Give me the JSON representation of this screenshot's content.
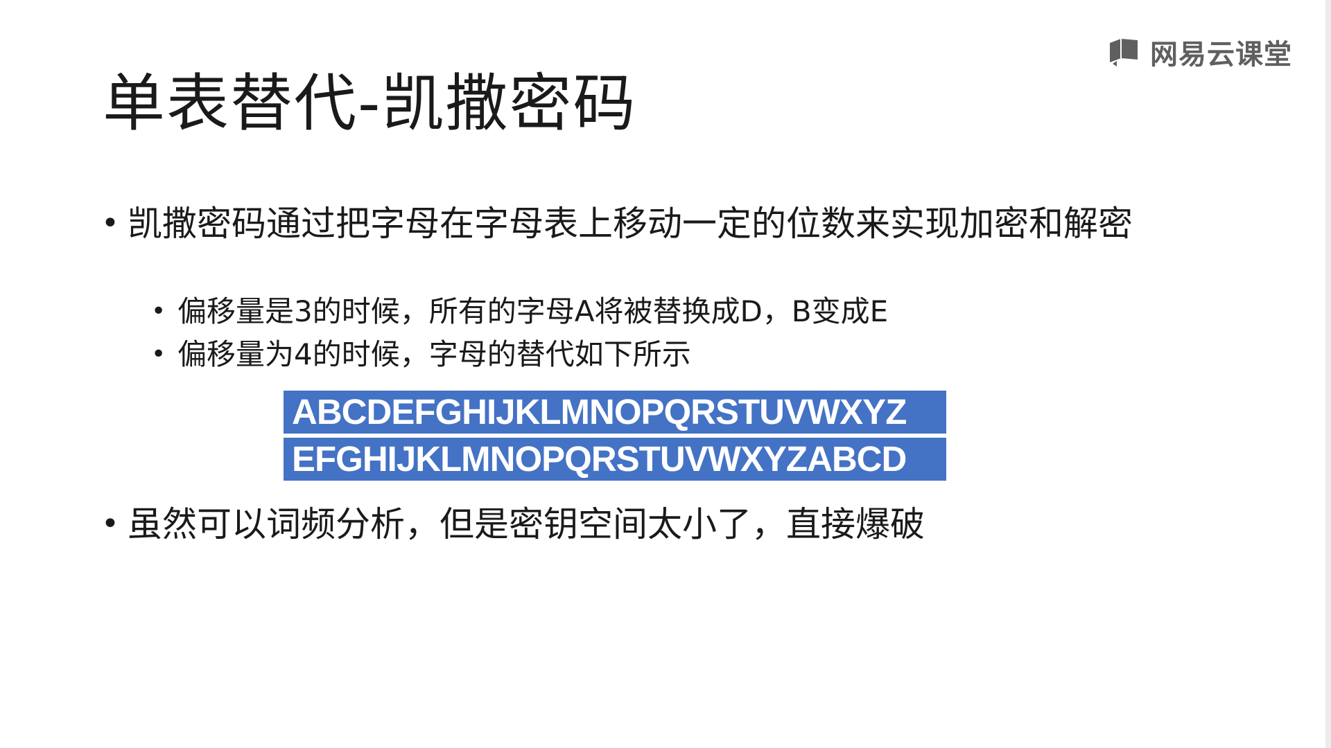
{
  "watermark": {
    "text": "网易云课堂",
    "icon": "book-icon"
  },
  "slide": {
    "title": "单表替代-凯撒密码",
    "bullets": [
      {
        "level": 1,
        "text": "凯撒密码通过把字母在字母表上移动一定的位数来实现加密和解密"
      },
      {
        "level": 2,
        "text": "偏移量是3的时候，所有的字母A将被替换成D，B变成E"
      },
      {
        "level": 2,
        "text": "偏移量为4的时候，字母的替代如下所示"
      },
      {
        "level": 1,
        "text": "虽然可以词频分析，但是密钥空间太小了，直接爆破"
      }
    ],
    "alphabet_table": {
      "plain_row": "ABCDEFGHIJKLMNOPQRSTUVWXYZ",
      "cipher_row": "EFGHIJKLMNOPQRSTUVWXYZABCD",
      "fill_color": "#4472c4",
      "text_color": "#ffffff"
    }
  }
}
